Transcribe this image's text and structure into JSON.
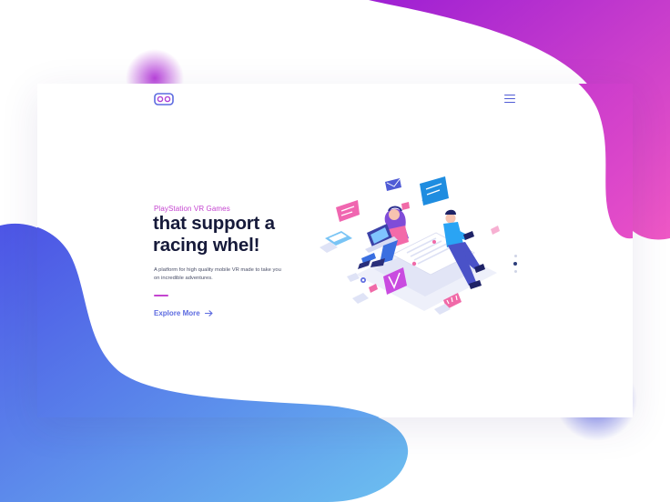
{
  "header": {
    "logo_icon": "vr-headset-icon",
    "menu_icon": "hamburger-menu-icon"
  },
  "hero": {
    "eyebrow": "PlayStation VR Games",
    "headline_line1": "that support a",
    "headline_line2": "racing whel!",
    "description_line1": "A platform for high quality mobile VR made to take you",
    "description_line2": "on incredible adventures.",
    "cta_label": "Explore More",
    "cta_icon": "arrow-right-icon"
  },
  "illustration": {
    "name": "isometric-people-with-devices-illustration"
  },
  "pagination": {
    "count": 3,
    "active_index": 1
  },
  "colors": {
    "accent_pink": "#c444d0",
    "accent_blue": "#5d6be0",
    "headline": "#161a3a",
    "purple_gradient_start": "#a21fd0",
    "purple_gradient_end": "#ea4fc8",
    "blue_gradient_start": "#4d5bea",
    "blue_gradient_end": "#6cb2ee"
  }
}
